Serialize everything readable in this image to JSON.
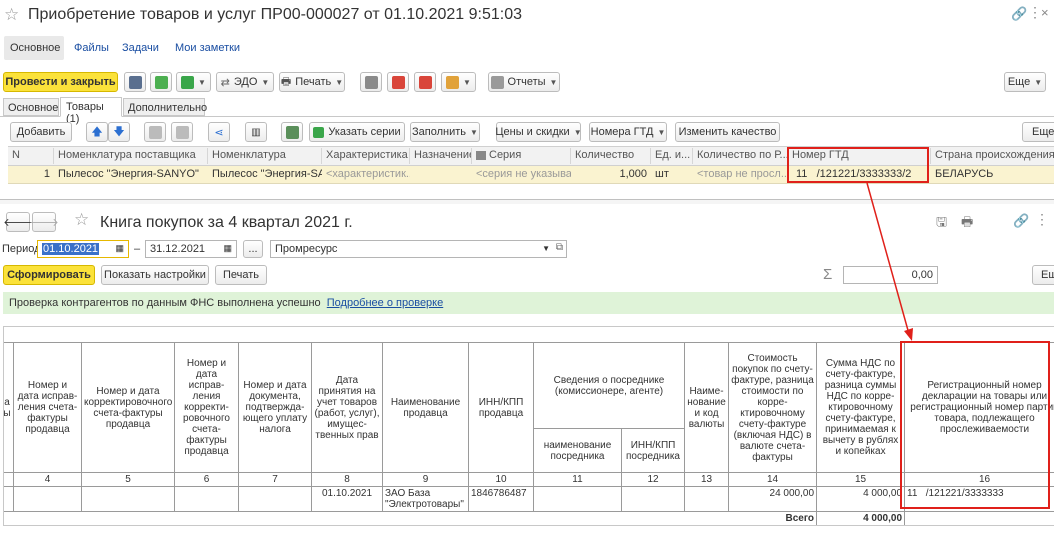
{
  "doc": {
    "title": "Приобретение товаров и услуг ПР00-000027 от 01.10.2021 9:51:03",
    "nav": [
      "Основное",
      "Файлы",
      "Задачи",
      "Мои заметки"
    ],
    "toolbar": {
      "post_close": "Провести и закрыть",
      "edo": "ЭДО",
      "print": "Печать",
      "reports": "Отчеты",
      "more": "Еще"
    },
    "tabs": [
      "Основное",
      "Товары (1)",
      "Дополнительно"
    ],
    "items_toolbar": {
      "add": "Добавить",
      "series": "Указать серии",
      "fill": "Заполнить",
      "prices": "Цены и скидки",
      "gtd": "Номера ГТД",
      "quality": "Изменить качество",
      "more": "Еще"
    },
    "columns": [
      "N",
      "Номенклатура поставщика",
      "Номенклатура",
      "Характеристика",
      "Назначение",
      "Серия",
      "Количество",
      "Ед. и...",
      "Количество по Р...",
      "Номер ГТД",
      "Страна происхождения"
    ],
    "row": {
      "n": "1",
      "supplier_item": "Пылесос \"Энергия-SANYO\"",
      "item": "Пылесос \"Энергия-SA...",
      "characteristic": "<характеристик...",
      "series": "<серия не указыва...",
      "qty": "1,000",
      "unit": "шт",
      "qty_r": "<товар не просл...",
      "gtd": "11   /121221/3333333/2",
      "country": "БЕЛАРУСЬ"
    }
  },
  "book": {
    "title": "Книга покупок за 4 квартал 2021 г.",
    "period_label": "Период:",
    "date_from": "01.10.2021",
    "dash": "–",
    "date_to": "31.12.2021",
    "dots": "...",
    "org": "Промресурс",
    "generate": "Сформировать",
    "show_settings": "Показать настройки",
    "print": "Печать",
    "sum_value": "0,00",
    "more": "Ещ",
    "notice": "Проверка контрагентов по данным ФНС выполнена успешно",
    "notice_link": "Подробнее о проверке",
    "headers": {
      "h3": "а\nы",
      "h4": "Номер и дата исправ­ления счета-фактуры продавца",
      "h5": "Номер и дата корректировочного счета-фактуры продавца",
      "h6": "Номер и дата исправ­ления корректи­ровочного счета-фактуры продавца",
      "h7": "Номер и дата документа, подтвержда­ющего уплату налога",
      "h8": "Дата принятия на учет товаров (работ, услуг), имущес­твенных прав",
      "h9": "Наименование продавца",
      "h10": "ИНН/КПП продавца",
      "h11_12": "Сведения о посреднике (комиссионере, агенте)",
      "h11": "наименование посредника",
      "h12": "ИНН/КПП посредника",
      "h13": "Наиме­нование и код валюты",
      "h14": "Стоимость покупок по счету-фактуре, разница стои­мости по корре­ктировочному счету-фактуре (включая НДС) в валюте счета-фактуры",
      "h15": "Сумма НДС по счету-фактуре, разница суммы НДС по корре­ктировочному счету-фактуре, принимаемая к вычету в рублях и копейках",
      "h16": "Регистрационный номер декларации на товары или регистрационный номер партии товара, подлежащего прослеживаемости"
    },
    "col_numbers": [
      "4",
      "5",
      "6",
      "7",
      "8",
      "9",
      "10",
      "11",
      "12",
      "13",
      "14",
      "15",
      "16"
    ],
    "data_row": {
      "date": "01.10.2021",
      "seller": "ЗАО База \"Электротовары\"",
      "inn": "1846786487",
      "cost": "24 000,00",
      "vat": "4 000,00",
      "gtd": "11   /121221/3333333"
    },
    "total_label": "Всего",
    "total_vat": "4 000,00"
  },
  "colors": {
    "accent_yellow": "#fbe23a",
    "highlight_red": "#e0201a",
    "notice_bg": "#dff3d8",
    "row_bg": "#faf3d0"
  }
}
